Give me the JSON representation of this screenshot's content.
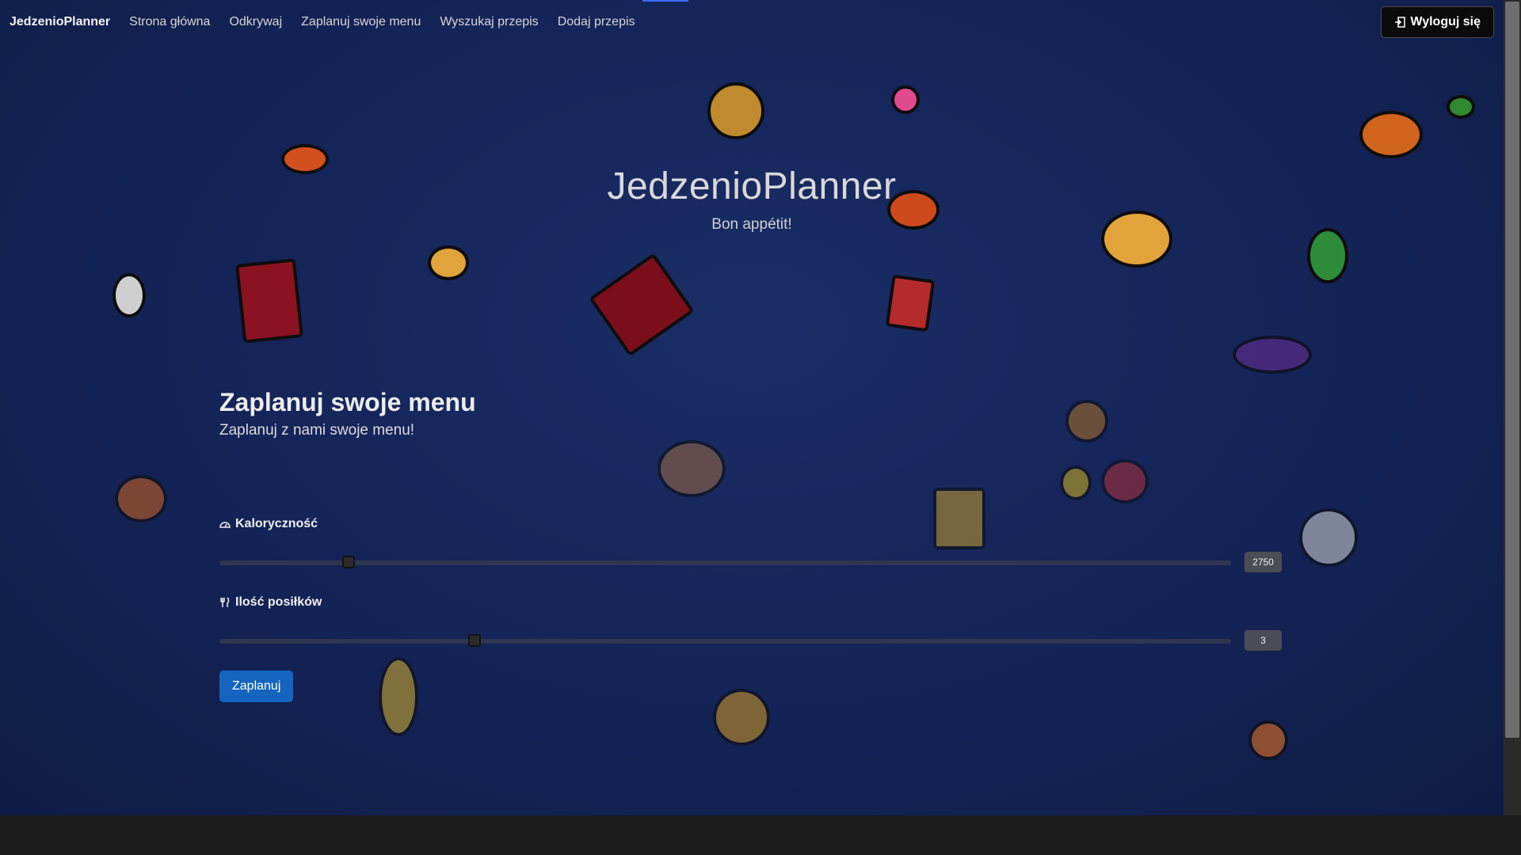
{
  "nav": {
    "brand": "JedzenioPlanner",
    "items": [
      {
        "label": "Strona główna"
      },
      {
        "label": "Odkrywaj"
      },
      {
        "label": "Zaplanuj swoje menu"
      },
      {
        "label": "Wyszukaj przepis"
      },
      {
        "label": "Dodaj przepis"
      }
    ],
    "logout_label": "Wyloguj się",
    "logout_icon": "logout-icon"
  },
  "hero": {
    "title": "JedzenioPlanner",
    "subtitle": "Bon appétit!"
  },
  "planner": {
    "title": "Zaplanuj swoje menu",
    "subtitle": "Zaplanuj z nami swoje menu!",
    "calories": {
      "label": "Kaloryczność",
      "icon": "gauge-icon",
      "value": "2750",
      "fraction": 0.128
    },
    "meals": {
      "label": "Ilość posiłków",
      "icon": "fork-knife-icon",
      "value": "3",
      "fraction": 0.252
    },
    "submit_label": "Zaplanuj"
  },
  "colors": {
    "background": "#15255a",
    "primary_button": "#1565c0",
    "nav_text": "#d6d6d6"
  }
}
